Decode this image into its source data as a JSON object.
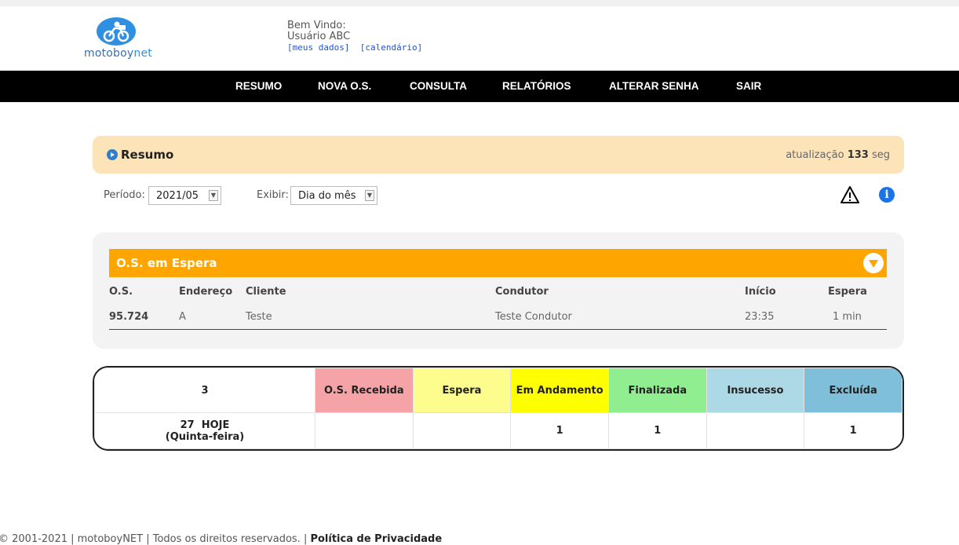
{
  "brand": {
    "logo_text_a": "motoboy",
    "logo_text_b": "net"
  },
  "header": {
    "welcome_line": "Bem Vindo:",
    "user_name": "Usuário ABC",
    "link_meus_dados": "[meus dados]",
    "link_calendario": "[calendário]"
  },
  "nav": {
    "items": [
      "RESUMO",
      "NOVA O.S.",
      "CONSULTA",
      "RELATÓRIOS",
      "ALTERAR SENHA",
      "SAIR"
    ]
  },
  "resumo": {
    "title": "Resumo",
    "update_label": "atualização",
    "update_value": "133",
    "update_unit": "seg"
  },
  "filters": {
    "periodo_label": "Período:",
    "periodo_value": "2021/05",
    "exibir_label": "Exibir:",
    "exibir_value": "Dia do mês"
  },
  "icons": {
    "warning": "warning-icon",
    "info": "info-icon"
  },
  "espera": {
    "title": "O.S. em Espera",
    "headers": [
      "O.S.",
      "Endereço",
      "Cliente",
      "Condutor",
      "Início",
      "Espera"
    ],
    "rows": [
      [
        "95.724",
        "A",
        "Teste",
        "Teste Condutor",
        "23:35",
        "1 min"
      ]
    ]
  },
  "status_table": {
    "count": "3",
    "columns": [
      {
        "label": "O.S. Recebida",
        "color": "#f5a3a6"
      },
      {
        "label": "Espera",
        "color": "#fdfd8e"
      },
      {
        "label": "Em Andamento",
        "color": "#ffff00"
      },
      {
        "label": "Finalizada",
        "color": "#90ee90"
      },
      {
        "label": "Insucesso",
        "color": "#add8e6"
      },
      {
        "label": "Excluída",
        "color": "#7fbfda"
      }
    ],
    "row_day": "27  HOJE",
    "row_weekday": "(Quinta-feira)",
    "row_values": [
      "",
      "",
      "1",
      "1",
      "",
      "1"
    ]
  },
  "footer": {
    "text": "© 2001-2021 | motoboyNET | Todos os direitos reservados. |",
    "privacy_link": "Política de Privacidade"
  },
  "colors": {
    "nav_bg": "#000000",
    "resumo_bg": "#fde3b8",
    "espera_header": "#ffa500"
  }
}
